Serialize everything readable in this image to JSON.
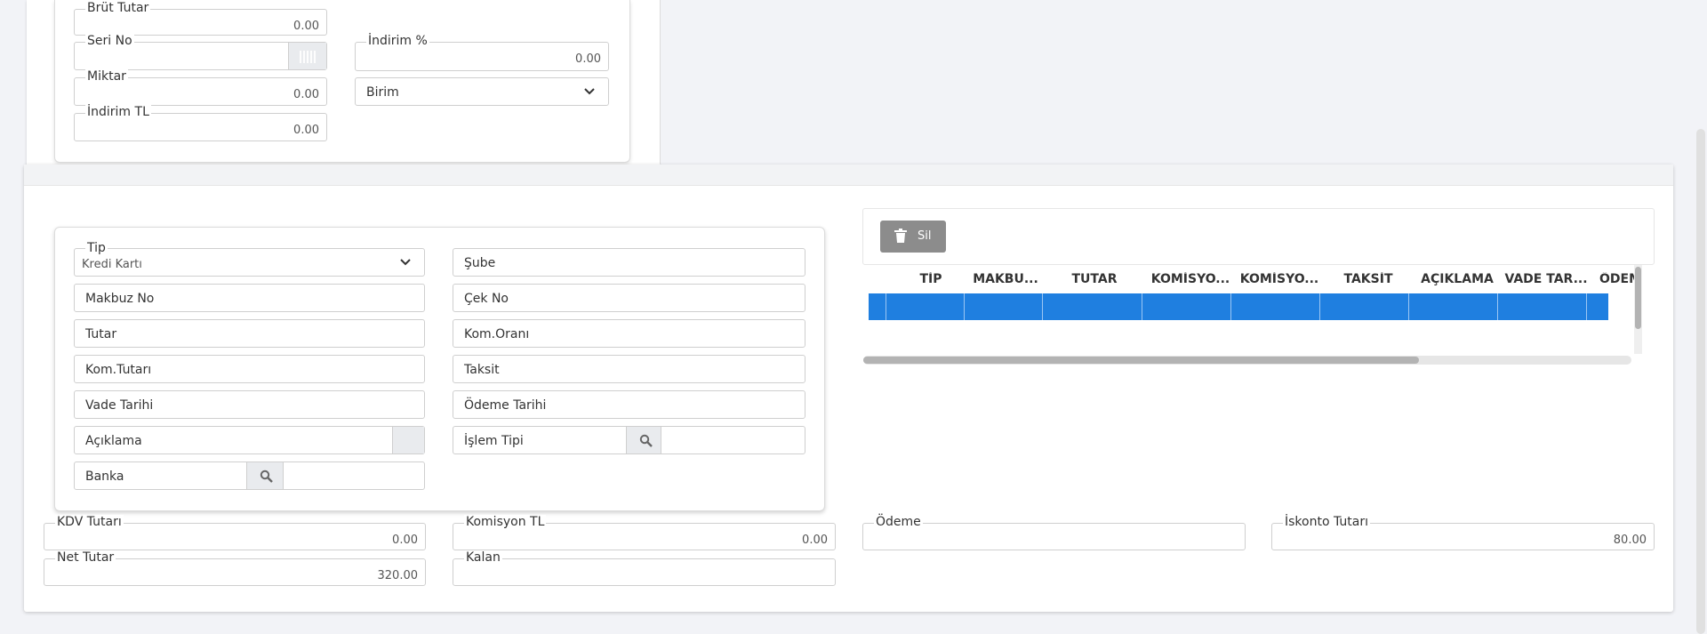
{
  "top_form": {
    "brut_tutar": {
      "label": "Brüt Tutar",
      "value": "0.00"
    },
    "seri_no": {
      "label": "Seri No"
    },
    "indirim_yuzde": {
      "label": "İndirim %",
      "value": "0.00"
    },
    "miktar": {
      "label": "Miktar",
      "value": "0.00"
    },
    "birim": {
      "label": "Birim"
    },
    "indirim_tl": {
      "label": "İndirim TL",
      "value": "0.00"
    }
  },
  "payment_form": {
    "tip": {
      "label": "Tip",
      "value": "Kredi Kartı"
    },
    "sube": {
      "label": "Şube"
    },
    "makbuz_no": {
      "label": "Makbuz No"
    },
    "cek_no": {
      "label": "Çek No"
    },
    "tutar": {
      "label": "Tutar"
    },
    "kom_orani": {
      "label": "Kom.Oranı"
    },
    "kom_tutari": {
      "label": "Kom.Tutarı"
    },
    "taksit": {
      "label": "Taksit"
    },
    "vade_tarihi": {
      "label": "Vade Tarihi"
    },
    "odeme_tarihi": {
      "label": "Ödeme Tarihi"
    },
    "aciklama": {
      "label": "Açıklama"
    },
    "islem_tipi": {
      "label": "İşlem Tipi"
    },
    "banka": {
      "label": "Banka"
    }
  },
  "grid": {
    "delete_label": "Sil",
    "columns": [
      "TİP",
      "MAKBU...",
      "TUTAR",
      "KOMİSYO...",
      "KOMİSYO...",
      "TAKSİT",
      "AÇIKLAMA",
      "VADE TAR...",
      "ÖDEM"
    ]
  },
  "totals": {
    "kdv_tutari": {
      "label": "KDV Tutarı",
      "value": "0.00"
    },
    "komisyon_tl": {
      "label": "Komisyon TL",
      "value": "0.00"
    },
    "odeme": {
      "label": "Ödeme"
    },
    "iskonto_tutari": {
      "label": "İskonto Tutarı",
      "value": "80.00"
    },
    "net_tutar": {
      "label": "Net Tutar",
      "value": "320.00"
    },
    "kalan": {
      "label": "Kalan"
    }
  },
  "colors": {
    "accent": "#1f7fe0",
    "button": "#8c8c8c"
  }
}
